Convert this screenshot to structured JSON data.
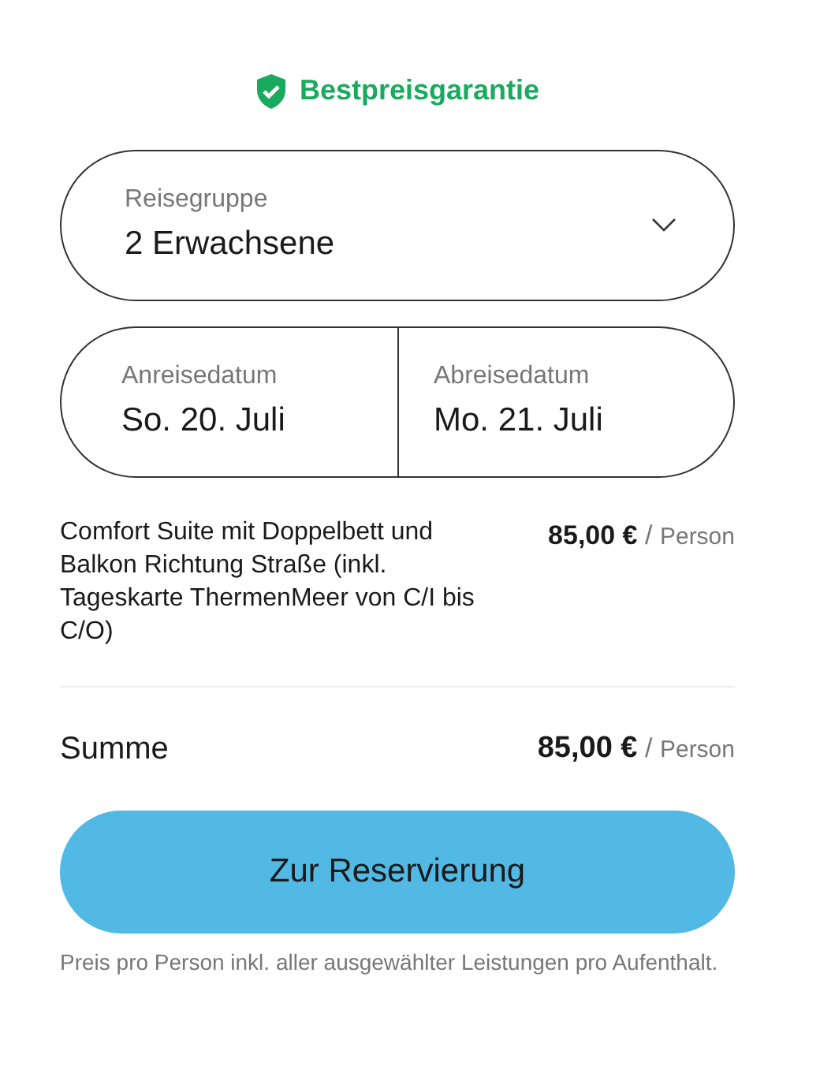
{
  "badge": {
    "label": "Bestpreisgarantie"
  },
  "travel_group": {
    "label": "Reisegruppe",
    "value": "2 Erwachsene"
  },
  "dates": [
    {
      "label": "Anreisedatum",
      "value": "So. 20. Juli"
    },
    {
      "label": "Abreisedatum",
      "value": "Mo. 21. Juli"
    }
  ],
  "items": [
    {
      "name": "Comfort Suite mit Doppelbett und Balkon Richtung Straße (inkl. Tageskarte ThermenMeer von C/I bis C/O)",
      "price": "85,00 €",
      "separator": "/",
      "unit": "Person"
    }
  ],
  "total": {
    "label": "Summe",
    "price": "85,00 €",
    "separator": "/",
    "unit": "Person"
  },
  "button": {
    "label": "Zur Reservierung"
  },
  "note": "Preis pro Person inkl. aller ausgewählter Leistungen pro Aufenthalt."
}
